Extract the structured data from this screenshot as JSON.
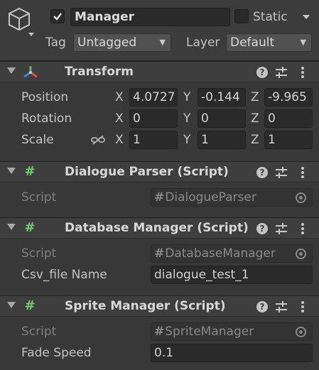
{
  "header": {
    "object_name": "Manager",
    "active": true,
    "static_label": "Static",
    "tag_label": "Tag",
    "tag_value": "Untagged",
    "layer_label": "Layer",
    "layer_value": "Default"
  },
  "transform": {
    "title": "Transform",
    "position_label": "Position",
    "rotation_label": "Rotation",
    "scale_label": "Scale",
    "axis_x": "X",
    "axis_y": "Y",
    "axis_z": "Z",
    "position": {
      "x": "4.0727",
      "y": "-0.144",
      "z": "-9.965"
    },
    "rotation": {
      "x": "0",
      "y": "0",
      "z": "0"
    },
    "scale": {
      "x": "1",
      "y": "1",
      "z": "1"
    }
  },
  "dialogue_parser": {
    "title": "Dialogue Parser (Script)",
    "script_label": "Script",
    "script_value": "DialogueParser"
  },
  "database_manager": {
    "title": "Database Manager (Script)",
    "script_label": "Script",
    "script_value": "DatabaseManager",
    "csv_label": "Csv_file Name",
    "csv_value": "dialogue_test_1"
  },
  "sprite_manager": {
    "title": "Sprite Manager (Script)",
    "script_label": "Script",
    "script_value": "SpriteManager",
    "fade_label": "Fade Speed",
    "fade_value": "0.1"
  },
  "colors": {
    "background": "#383838",
    "field": "#2a2a2a",
    "script_icon": "#6cd06c"
  },
  "icons": [
    "gameobject-cube-icon",
    "checkmark-icon",
    "transform-axes-icon",
    "script-hash-icon",
    "help-icon",
    "preset-sliders-icon",
    "kebab-menu-icon",
    "link-constrain-icon",
    "object-picker-icon"
  ]
}
